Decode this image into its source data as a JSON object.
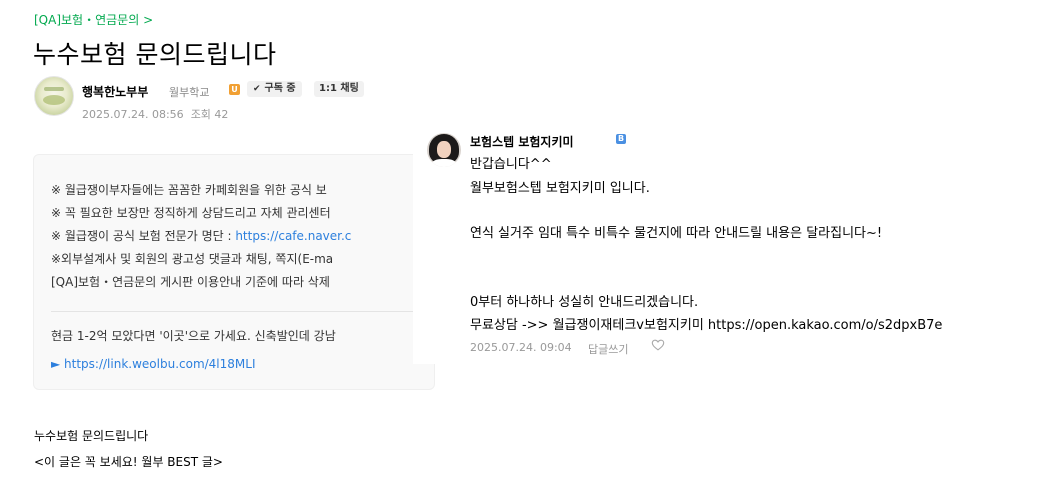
{
  "post": {
    "board": "[QA]보험・연금문의 >",
    "title": "누수보험 문의드립니다",
    "author": "행복한노부부",
    "level": "월부학교",
    "level_badge": "U",
    "subscribe_label": "구독 중",
    "chat_label": "1:1 채팅",
    "date": "2025.07.24. 08:56",
    "views": "조회 42"
  },
  "notice": {
    "lines": [
      "※ 월급쟁이부자들에는 꼼꼼한 카페회원을 위한 공식 보",
      "※ 꼭 필요한 보장만 정직하게 상담드리고 자체 관리센터",
      "※ 월급쟁이 공식 보험 전문가 명단 : ",
      "※외부설계사 및 회원의 광고성 댓글과 채팅, 쪽지(E-ma",
      "[QA]보험・연금문의 게시판 이용안내 기준에 따라 삭제"
    ],
    "expert_link": "https://cafe.naver.c",
    "promo": "현금 1-2억 모았다면 '이곳'으로 가세요. 신축발인데 강남",
    "promo_link": "► https://link.weolbu.com/4l18MLI"
  },
  "body": {
    "line1": "누수보험 문의드립니다",
    "line2": "<이 글은 꼭 보세요! 월부 BEST 글>"
  },
  "comment": {
    "author": "보험스텝 보험지키미",
    "badge": "B",
    "lines": [
      "반갑습니다^^",
      "월부보험스텝 보험지키미 입니다.",
      "연식 실거주 임대 특수 비특수 물건지에 따라 안내드릴 내용은 달라집니다~!",
      "0부터 하나하나 성실히 안내드리겠습니다.",
      "무료상담 ->> 월급쟁이재테크v보험지키미 https://open.kakao.com/o/s2dpxB7e"
    ],
    "date": "2025.07.24. 09:04",
    "reply_label": "답글쓰기"
  }
}
